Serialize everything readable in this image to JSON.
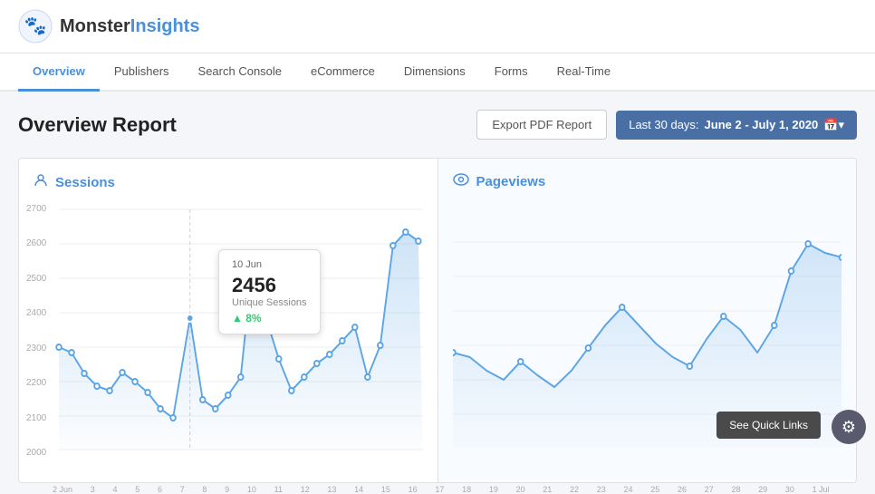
{
  "header": {
    "logo_text_normal": "Monster",
    "logo_text_colored": "Insights"
  },
  "nav": {
    "items": [
      {
        "label": "Overview",
        "active": true
      },
      {
        "label": "Publishers",
        "active": false
      },
      {
        "label": "Search Console",
        "active": false
      },
      {
        "label": "eCommerce",
        "active": false
      },
      {
        "label": "Dimensions",
        "active": false
      },
      {
        "label": "Forms",
        "active": false
      },
      {
        "label": "Real-Time",
        "active": false
      }
    ]
  },
  "report": {
    "title": "Overview Report",
    "export_label": "Export PDF Report",
    "date_range_prefix": "Last 30 days:",
    "date_range": "June 2 - July 1, 2020"
  },
  "sessions_panel": {
    "title": "Sessions",
    "icon": "👤"
  },
  "pageviews_panel": {
    "title": "Pageviews",
    "icon": "👁"
  },
  "tooltip": {
    "date": "10 Jun",
    "value": "2456",
    "label": "Unique Sessions",
    "change": "8%",
    "change_direction": "up"
  },
  "y_axis": {
    "labels": [
      "2700",
      "2600",
      "2500",
      "2400",
      "2300",
      "2200",
      "2100",
      "2000"
    ]
  },
  "x_axis": {
    "labels": [
      "2 Jun",
      "3",
      "4",
      "5",
      "6",
      "7",
      "8",
      "9",
      "10",
      "11",
      "12",
      "13",
      "14",
      "15",
      "16",
      "17",
      "18",
      "19",
      "20",
      "21",
      "22",
      "23",
      "24",
      "25",
      "26",
      "27",
      "28",
      "29",
      "30",
      "1 Jul"
    ]
  },
  "quick_links": {
    "label": "See Quick Links"
  },
  "colors": {
    "accent": "#4a90d9",
    "nav_active": "#4a90d9",
    "date_btn_bg": "#4a6fa5",
    "chart_line": "#5ba4e5",
    "chart_fill": "rgba(91,164,229,0.15)",
    "tooltip_change": "#2ecc71"
  }
}
